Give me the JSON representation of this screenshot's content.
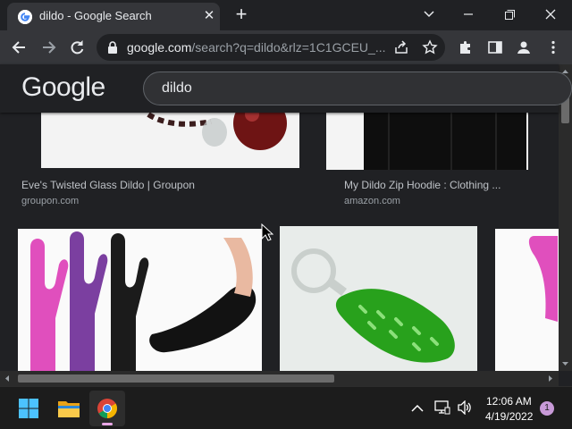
{
  "browser": {
    "tab_title": "dildo - Google Search",
    "url_host": "google.com",
    "url_rest": "/search?q=dildo&rlz=1C1GCEU_..."
  },
  "google": {
    "logo": "Google",
    "query": "dildo"
  },
  "results": [
    {
      "caption": "Eve's Twisted Glass Dildo | Groupon",
      "source": "groupon.com"
    },
    {
      "caption": "My Dildo Zip Hoodie : Clothing ...",
      "source": "amazon.com"
    }
  ],
  "taskbar": {
    "time": "12:06 AM",
    "date": "4/19/2022",
    "notification_count": "1"
  },
  "icons": [
    "google-favicon",
    "close-icon",
    "plus-icon",
    "chevron-down-icon",
    "minimize-icon",
    "restore-icon",
    "back-arrow-icon",
    "forward-arrow-icon",
    "reload-icon",
    "lock-icon",
    "share-icon",
    "star-icon",
    "puzzle-icon",
    "side-panel-icon",
    "profile-icon",
    "kebab-menu-icon",
    "windows-start-icon",
    "file-explorer-icon",
    "chrome-icon",
    "chevron-up-icon",
    "network-icon",
    "volume-icon",
    "mouse-cursor-icon"
  ],
  "colors": {
    "dark_bg": "#202124",
    "toolbar": "#35363a",
    "text": "#e8eaed",
    "muted": "#9aa0a6",
    "pink": "#e04fbd",
    "purple": "#7b3fa0",
    "green": "#28a11c"
  }
}
